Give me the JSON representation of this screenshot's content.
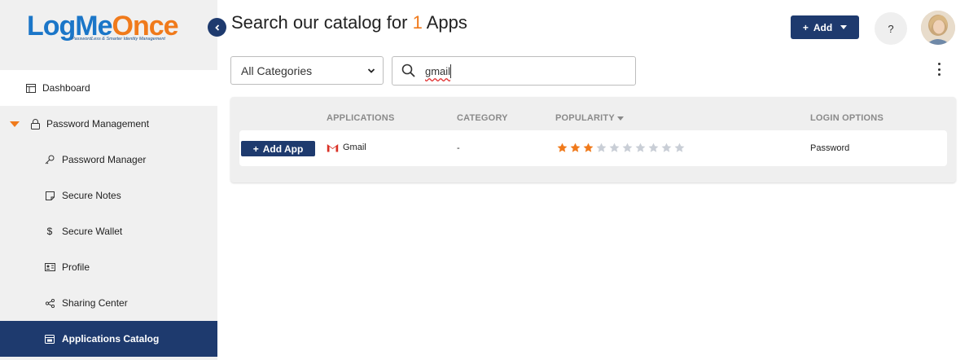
{
  "logo": {
    "part1": "LogMe",
    "part2": "Once",
    "tagline": "PasswordLess & Smarter Identity Management"
  },
  "sidebar": {
    "items": [
      {
        "label": "Dashboard",
        "icon": "dashboard-icon"
      },
      {
        "label": "Password Management",
        "icon": "lock-icon"
      },
      {
        "label": "Password Manager",
        "icon": "key-icon"
      },
      {
        "label": "Secure Notes",
        "icon": "note-icon"
      },
      {
        "label": "Secure Wallet",
        "icon": "dollar-icon"
      },
      {
        "label": "Profile",
        "icon": "id-card-icon"
      },
      {
        "label": "Sharing Center",
        "icon": "share-icon"
      },
      {
        "label": "Applications Catalog",
        "icon": "catalog-icon"
      }
    ]
  },
  "header": {
    "title_prefix": "Search our catalog for",
    "count": "1",
    "title_suffix": "Apps",
    "add_label": "Add",
    "help_label": "?"
  },
  "filters": {
    "category_selected": "All Categories",
    "search_value": "gmail"
  },
  "table": {
    "columns": [
      "APPLICATIONS",
      "CATEGORY",
      "POPULARITY",
      "LOGIN OPTIONS"
    ],
    "rows": [
      {
        "action_label": "Add App",
        "app": "Gmail",
        "category": "-",
        "popularity": 3,
        "popularity_max": 10,
        "login_option": "Password"
      }
    ]
  },
  "colors": {
    "primary": "#1e3a6e",
    "accent": "#f07a1b",
    "star_empty": "#c9ced6"
  }
}
